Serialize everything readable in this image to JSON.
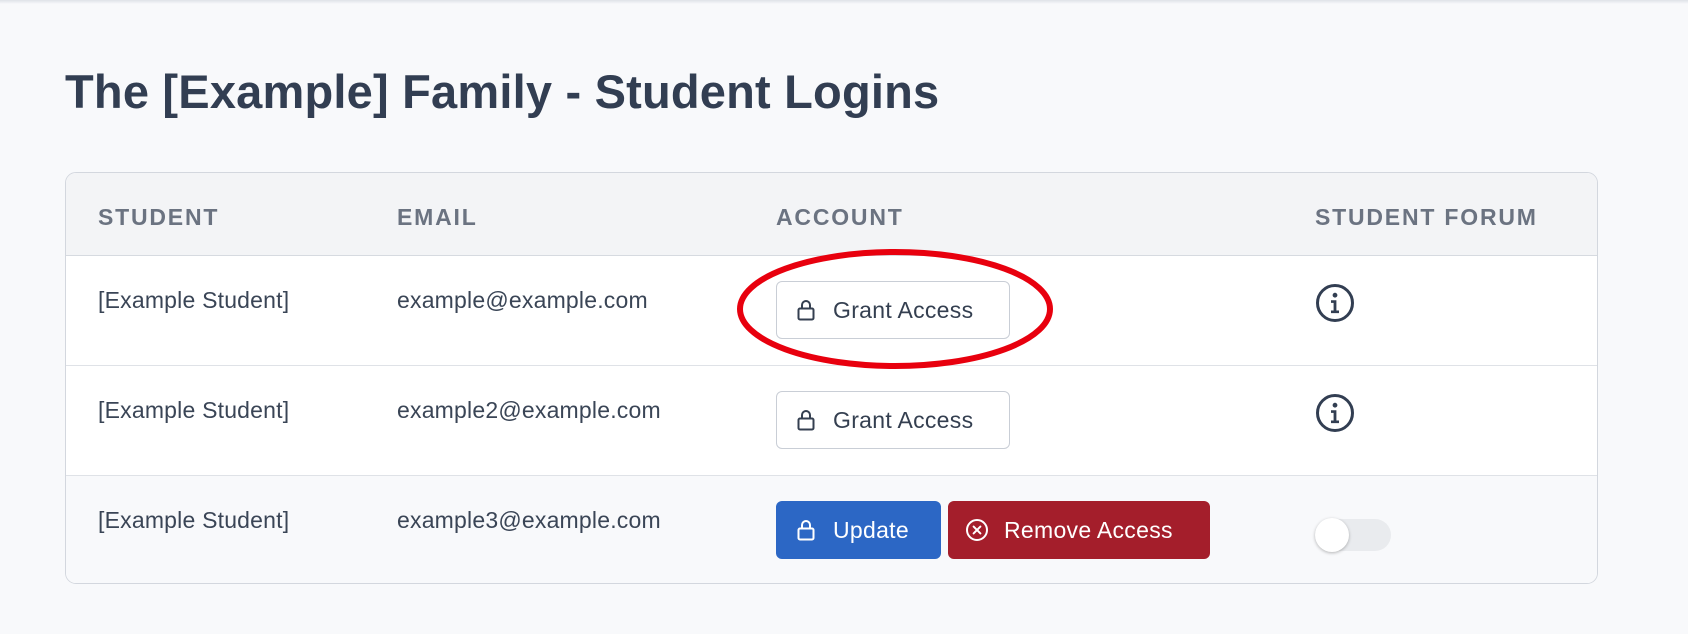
{
  "page": {
    "title": "The [Example] Family - Student Logins"
  },
  "table": {
    "headers": {
      "student": "STUDENT",
      "email": "EMAIL",
      "account": "ACCOUNT",
      "student_forum": "STUDENT FORUM"
    },
    "rows": [
      {
        "student": "[Example Student]",
        "email": "example@example.com",
        "account_action": "Grant Access",
        "forum": "info-icon"
      },
      {
        "student": "[Example Student]",
        "email": "example2@example.com",
        "account_action": "Grant Access",
        "forum": "info-icon"
      },
      {
        "student": "[Example Student]",
        "email": "example3@example.com",
        "update_label": "Update",
        "remove_label": "Remove Access",
        "forum_toggle_on": false
      }
    ]
  },
  "icons": {
    "lock": "lock-icon",
    "remove": "x-circle-icon",
    "info": "info-icon"
  },
  "colors": {
    "background": "#f8f9fb",
    "title": "#323e52",
    "primary_button": "#2c67c5",
    "danger_button": "#a41e2b",
    "highlight": "#e8000e"
  }
}
